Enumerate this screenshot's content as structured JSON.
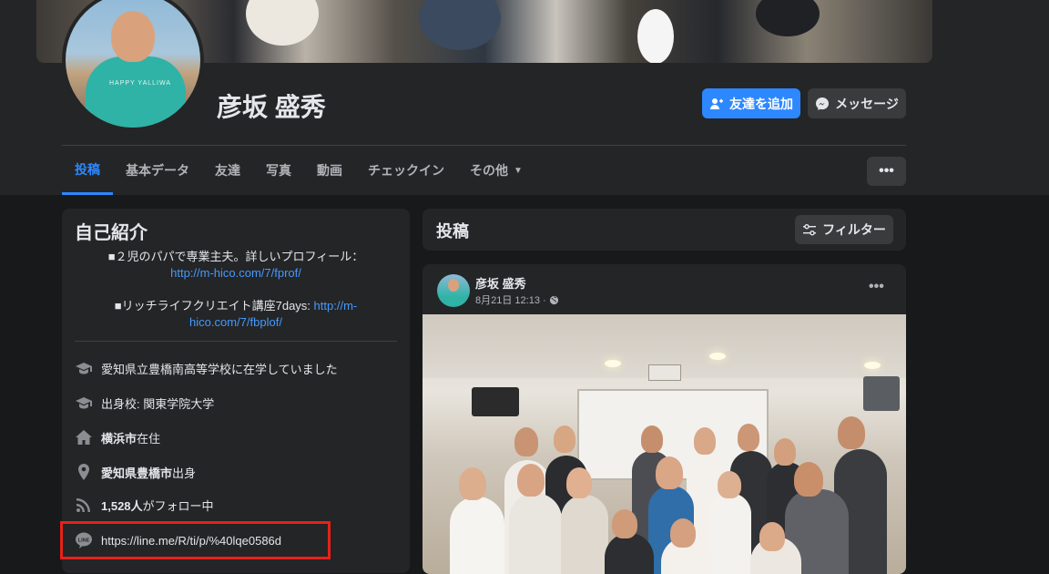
{
  "profile": {
    "name": "彦坂 盛秀",
    "avatar_shirt_text": "HAPPY YALLIWA"
  },
  "actions": {
    "add_friend_label": "友達を追加",
    "message_label": "メッセージ"
  },
  "tabs": [
    {
      "label": "投稿",
      "active": true
    },
    {
      "label": "基本データ"
    },
    {
      "label": "友達"
    },
    {
      "label": "写真"
    },
    {
      "label": "動画"
    },
    {
      "label": "チェックイン"
    },
    {
      "label": "その他"
    }
  ],
  "more_label": "•••",
  "intro": {
    "title": "自己紹介",
    "bio1_text": "■２児のパパで専業主夫。詳しいプロフィール：",
    "bio1_link": "http://m-hico.com/7/fprof/",
    "bio2_text": "■リッチライフクリエイト講座7days: ",
    "bio2_link_a": "http://m-",
    "bio2_link_b": "hico.com/7/fbplof/",
    "items": {
      "highschool": "愛知県立豊橋南高等学校に在学していました",
      "university": "出身校: 関東学院大学",
      "lives_bold": "横浜市",
      "lives_rest": "在住",
      "from_bold1": "愛知県 ",
      "from_bold2": "豊橋市",
      "from_rest": "出身",
      "followers_bold": "1,528人",
      "followers_rest": "がフォロー中",
      "line_url": "https://line.me/R/ti/p/%40lqe0586d"
    }
  },
  "posts": {
    "title": "投稿",
    "filter_label": "フィルター",
    "post": {
      "author": "彦坂 盛秀",
      "date": "8月21日 12:13 ·",
      "more": "•••"
    }
  },
  "colors": {
    "accent": "#2d88ff",
    "highlight": "#e8201a",
    "card": "#242526",
    "page": "#18191a"
  }
}
